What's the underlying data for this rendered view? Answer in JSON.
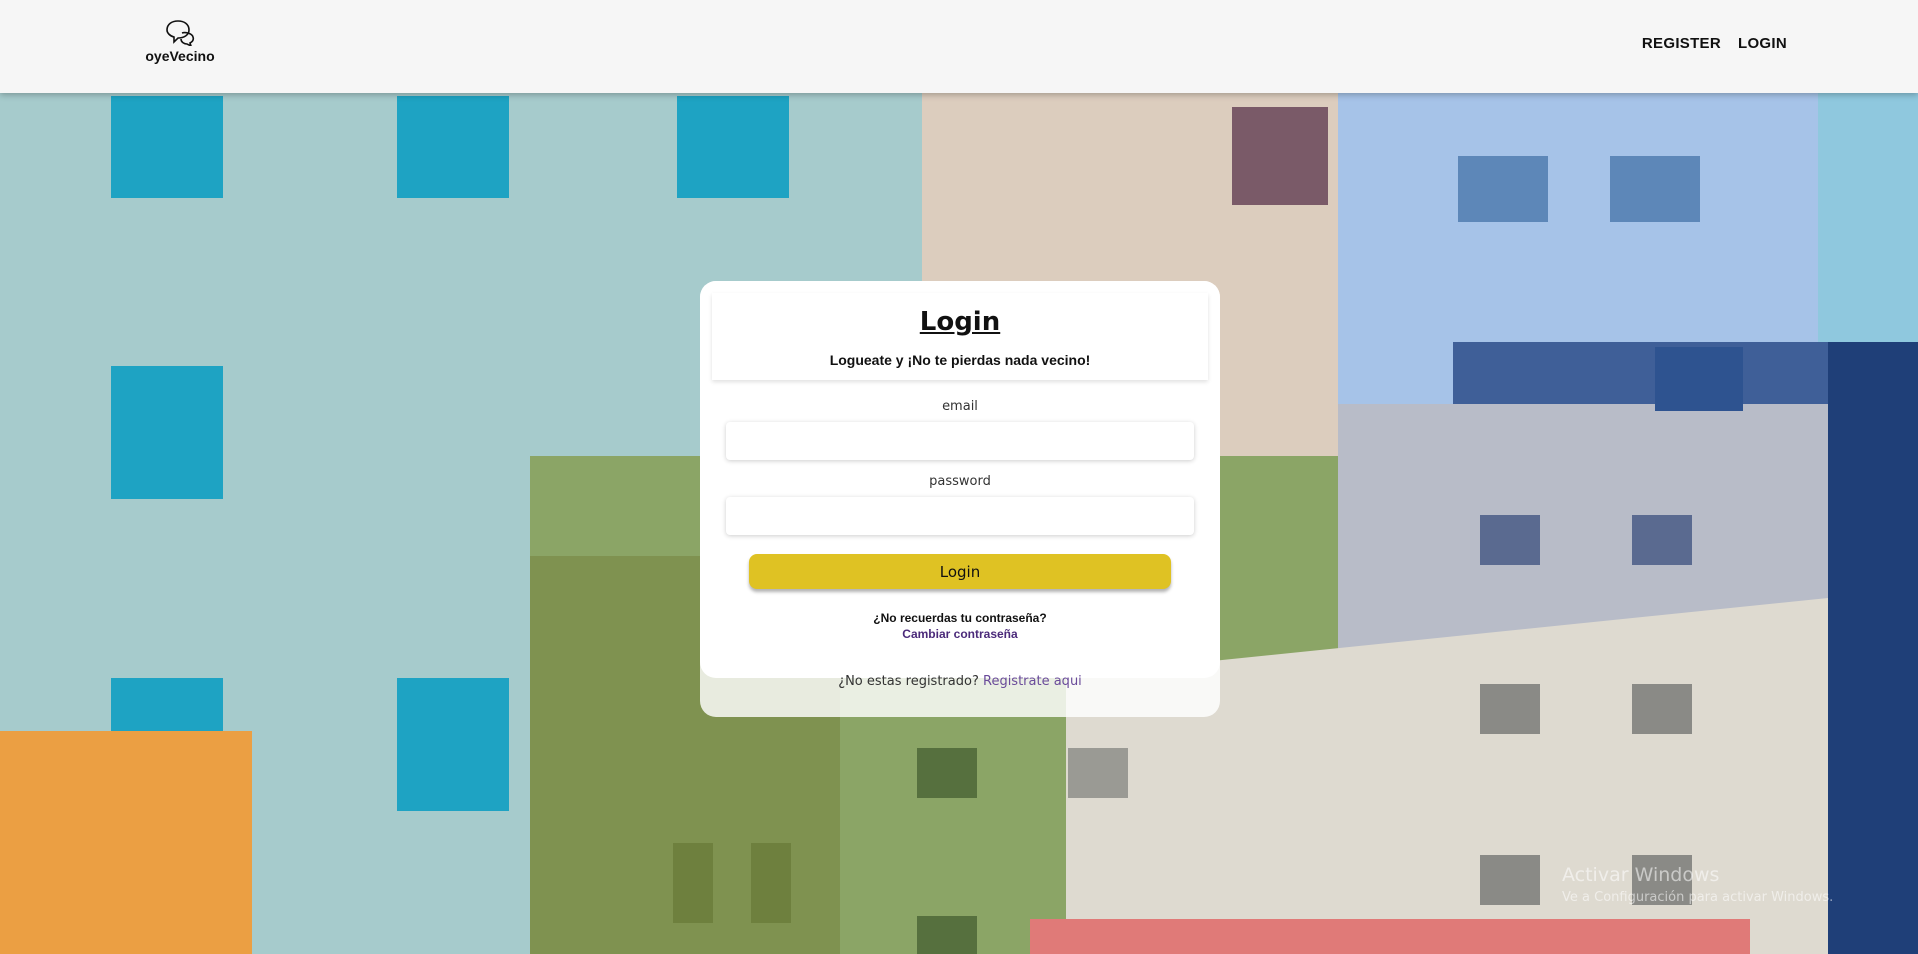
{
  "header": {
    "logo_text": "oyeVecino",
    "nav": {
      "register": "REGISTER",
      "login": "LOGIN"
    }
  },
  "login_card": {
    "title": "Login",
    "subtitle": "Logueate y ¡No te pierdas nada vecino!",
    "email_label": "email",
    "email_value": "",
    "password_label": "password",
    "password_value": "",
    "login_button": "Login",
    "forgot_question": "¿No recuerdas tu contraseña?",
    "forgot_link": "Cambiar contraseña",
    "register_prompt": "¿No estas registrado?",
    "register_link": "Registrate aqui"
  },
  "colors": {
    "header_bg": "#f6f6f6",
    "button": "#dfc223",
    "link": "#4b2a7a"
  },
  "watermark": {
    "title": "Activar Windows",
    "subtitle": "Ve a Configuración para activar Windows."
  }
}
